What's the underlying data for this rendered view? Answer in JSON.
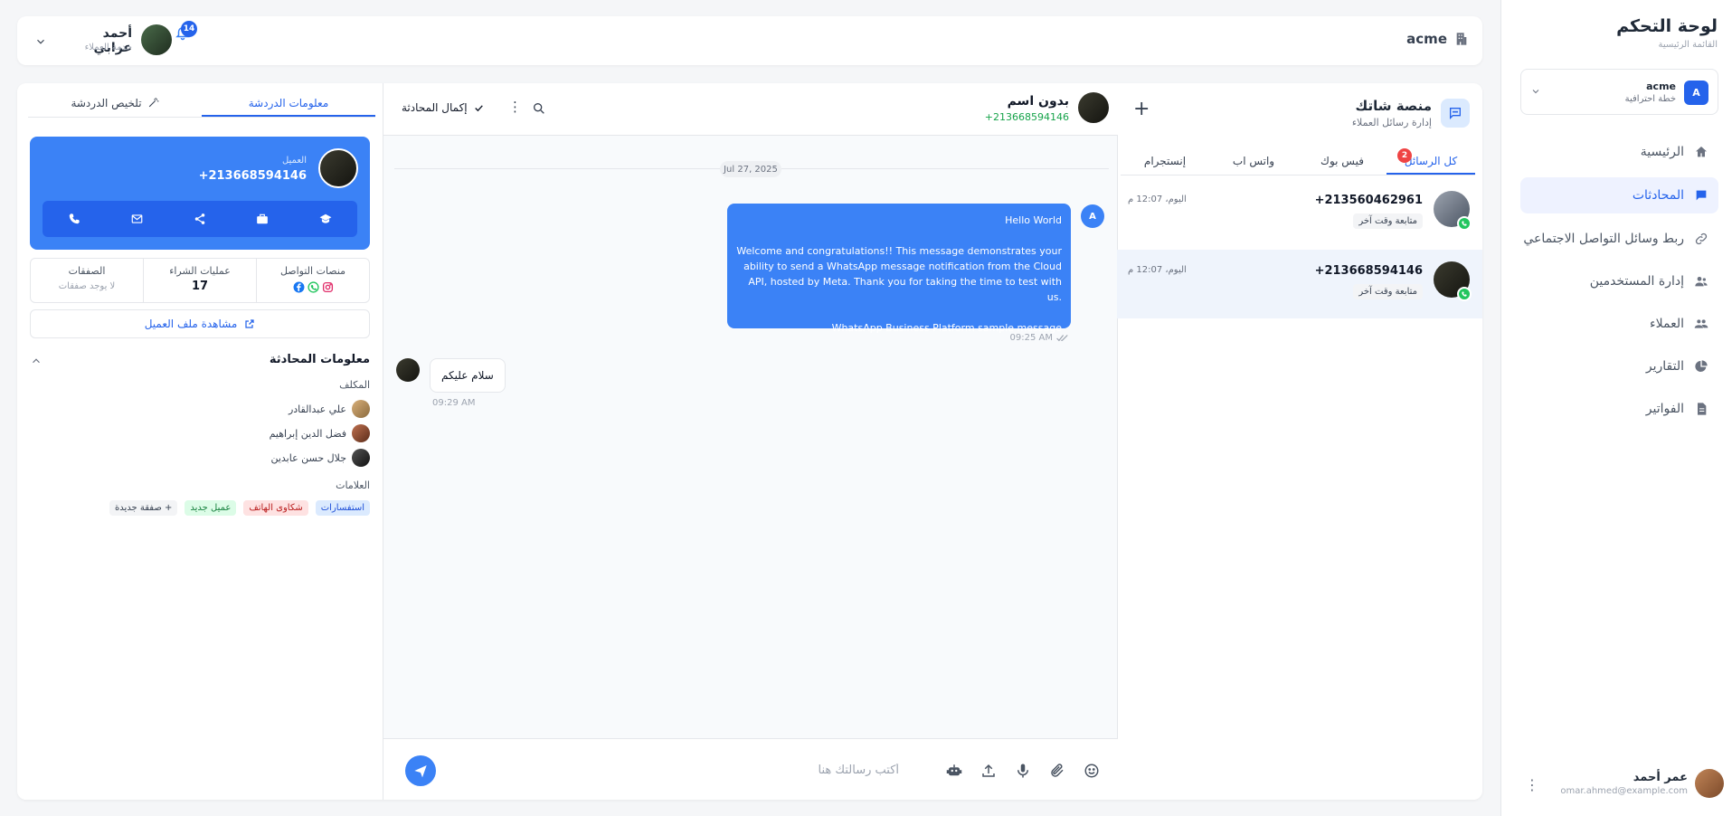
{
  "sidebar": {
    "title": "لوحة التحكم",
    "subtitle": "القائمة الرئيسية",
    "workspace": {
      "initial": "A",
      "name": "acme",
      "plan": "خطة احترافية"
    },
    "items": [
      {
        "label": "الرئيسية",
        "icon": "home-icon",
        "active": false
      },
      {
        "label": "المحادثات",
        "icon": "chat-icon",
        "active": true
      },
      {
        "label": "ربط وسائل التواصل الاجتماعي",
        "icon": "link-icon",
        "active": false
      },
      {
        "label": "إدارة المستخدمين",
        "icon": "users-icon",
        "active": false
      },
      {
        "label": "العملاء",
        "icon": "customers-icon",
        "active": false
      },
      {
        "label": "التقارير",
        "icon": "pie-chart-icon",
        "active": false
      },
      {
        "label": "الفواتير",
        "icon": "invoice-icon",
        "active": false
      }
    ],
    "user": {
      "name": "عمر أحمد",
      "email": "omar.ahmed@example.com"
    }
  },
  "header": {
    "org": "acme",
    "user_name": "أحمد عرابي",
    "user_role": "خدمة العملاء",
    "notifications": "14"
  },
  "conversations": {
    "title": "منصة شاتك",
    "subtitle": "إدارة رسائل العملاء",
    "tabs": [
      {
        "label": "كل الرسائل",
        "active": true,
        "badge": "2"
      },
      {
        "label": "فيس بوك",
        "active": false
      },
      {
        "label": "واتس اب",
        "active": false
      },
      {
        "label": "إنستجرام",
        "active": false
      }
    ],
    "items": [
      {
        "phone": "+213560462961",
        "time": "اليوم، 12:07 م",
        "tag": "متابعة وقت آخر",
        "selected": false
      },
      {
        "phone": "+213668594146",
        "time": "اليوم، 12:07 م",
        "tag": "متابعة وقت آخر",
        "selected": true
      }
    ]
  },
  "chat": {
    "name": "بدون اسم",
    "phone": "+213668594146",
    "complete_label": "إكمال المحادثة",
    "date": "Jul 27, 2025",
    "outgoing": {
      "avatar": "A",
      "line1": "Hello World",
      "line2": "Welcome and congratulations!! This message demonstrates your ability to send a WhatsApp message notification from the Cloud API, hosted by Meta. Thank you for taking the time to test with us.",
      "line3": "WhatsApp Business Platform sample message",
      "time": "09:25 AM"
    },
    "incoming": {
      "text": "سلام عليكم",
      "time": "09:29 AM"
    },
    "composer_placeholder": "أكتب رسالتك هنا"
  },
  "info": {
    "tabs": [
      {
        "label": "معلومات الدردشة",
        "active": true
      },
      {
        "label": "تلخيص الدردشة",
        "active": false
      }
    ],
    "customer_label": "العميل",
    "customer_phone": "+213668594146",
    "stats": [
      {
        "label": "منصات التواصل"
      },
      {
        "label": "عمليات الشراء",
        "value": "17"
      },
      {
        "label": "الصفقات",
        "note": "لا يوجد صفقات"
      }
    ],
    "view_profile": "مشاهدة ملف العميل",
    "section_title": "معلومات المحادثة",
    "assigned_label": "المكلف",
    "assignees": [
      "علي عبدالقادر",
      "فضل الدين إبراهيم",
      "جلال حسن عابدين"
    ],
    "tags_label": "العلامات",
    "tags": [
      {
        "label": "استفسارات",
        "bg": "#dbeafe",
        "fg": "#1d4ed8"
      },
      {
        "label": "شكاوى الهاتف",
        "bg": "#fee2e2",
        "fg": "#b91c1c"
      },
      {
        "label": "عميل جديد",
        "bg": "#dcfce7",
        "fg": "#15803d"
      },
      {
        "label": "صفقة جديدة +",
        "bg": "#f3f4f6",
        "fg": "#374151"
      }
    ]
  },
  "colors": {
    "accent": "#3b82f6",
    "whatsapp": "#22c55e",
    "badge": "#ef4444"
  }
}
